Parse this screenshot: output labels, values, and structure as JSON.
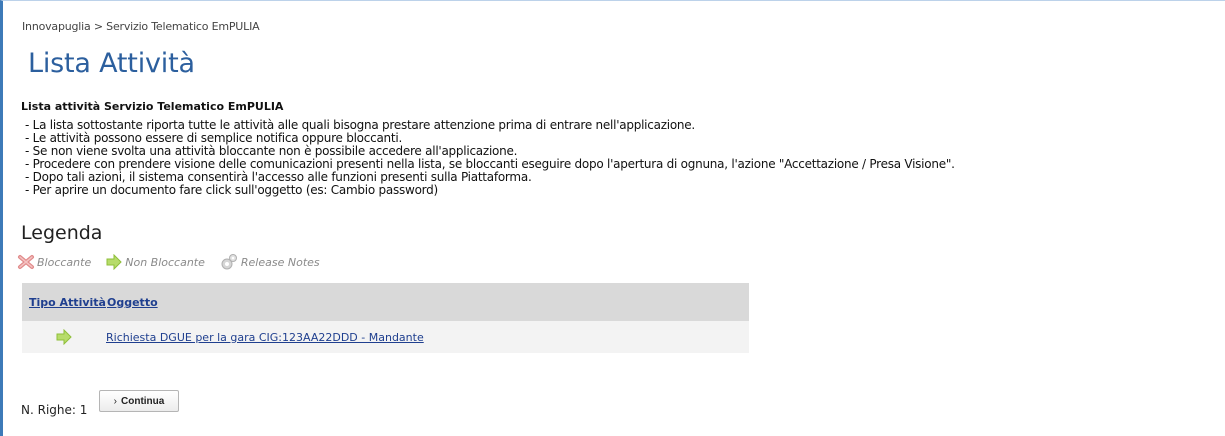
{
  "breadcrumb": "Innovapuglia > Servizio Telematico EmPULIA",
  "page_title": "Lista Attività",
  "intro": {
    "title": "Lista attività Servizio Telematico EmPULIA",
    "lines": [
      "- La lista sottostante riporta tutte le attività alle quali bisogna prestare attenzione prima di entrare nell'applicazione.",
      "- Le attività possono essere di semplice notifica oppure bloccanti.",
      "- Se non viene svolta una attività bloccante non è possibile accedere all'applicazione.",
      "- Procedere con prendere visione delle comunicazioni presenti nella lista, se bloccanti eseguire dopo l'apertura di ognuna, l'azione \"Accettazione / Presa Visione\".",
      "- Dopo tali azioni, il sistema consentirà l'accesso alle funzioni presenti sulla Piattaforma.",
      "- Per aprire un documento fare click sull'oggetto (es: Cambio password)"
    ]
  },
  "legend": {
    "title": "Legenda",
    "items": [
      {
        "label": "Bloccante",
        "icon": "blocking-x-icon"
      },
      {
        "label": "Non Bloccante",
        "icon": "green-arrow-icon"
      },
      {
        "label": "Release Notes",
        "icon": "gear-icon"
      }
    ]
  },
  "table": {
    "headers": {
      "type": "Tipo Attività",
      "object": "Oggetto"
    },
    "rows": [
      {
        "type_icon": "green-arrow-icon",
        "object": "Richiesta DGUE per la gara CIG:123AA22DDD - Mandante"
      }
    ]
  },
  "footer": {
    "rows_count": "N. Righe: 1",
    "continue_label": "Continua",
    "continue_chevron": "›"
  },
  "colors": {
    "title": "#2c5f9e",
    "link": "#1f3f8f",
    "header_bg": "#d9d9d9",
    "row_bg": "#f3f3f3",
    "arrow_green": "#9ccc3c"
  }
}
